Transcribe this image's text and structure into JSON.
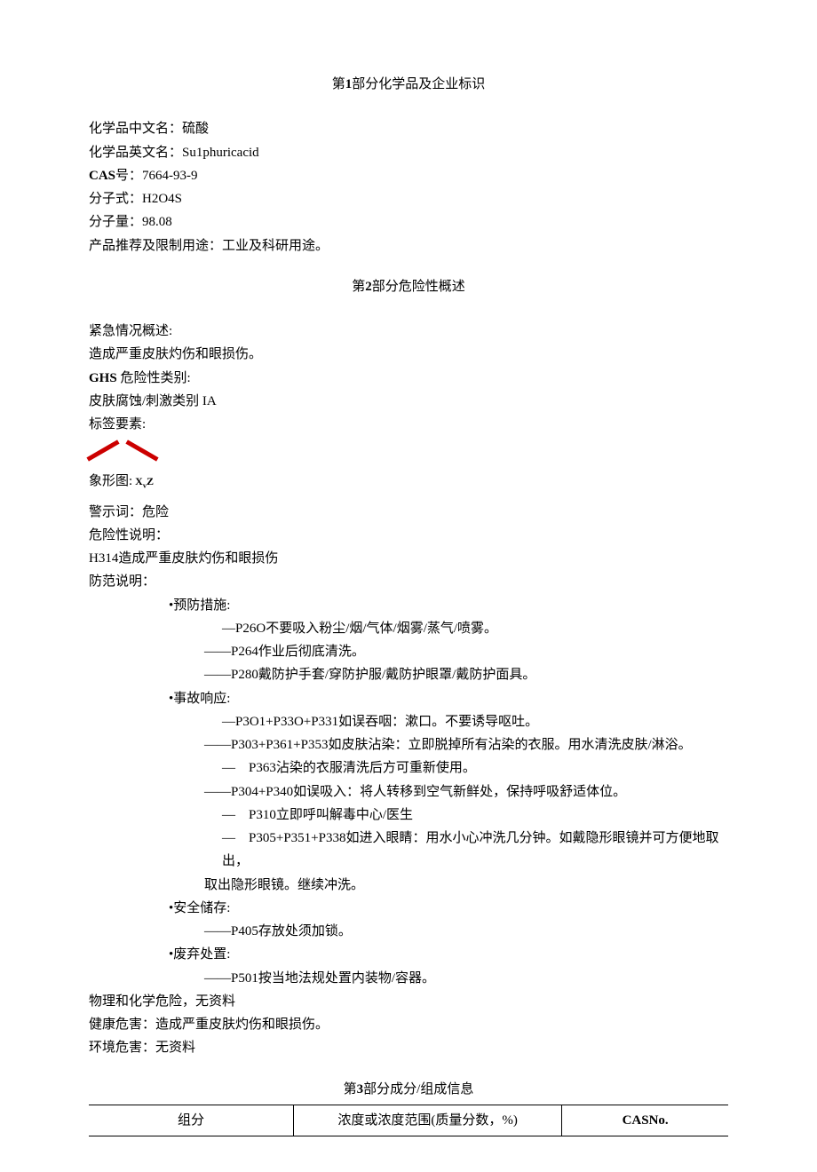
{
  "section1": {
    "title_pre": "第",
    "title_num": "1",
    "title_post": "部分化学品及企业标识",
    "cn_name_label": "化学品中文名：",
    "cn_name_value": "硫酸",
    "en_name_label": "化学品英文名：",
    "en_name_value": "Su1phuricacid",
    "cas_label": "CAS",
    "cas_sep": "号：",
    "cas_value": "7664-93-9",
    "formula_label": "分子式：",
    "formula_value": "H2O4S",
    "mw_label": "分子量：",
    "mw_value": "98.08",
    "usage_label": "产品推荐及限制用途：",
    "usage_value": "工业及科研用途。"
  },
  "section2": {
    "title_pre": "第",
    "title_num": "2",
    "title_post": "部分危险性概述",
    "emergency_label": "紧急情况概述:",
    "emergency_value": "造成严重皮肤灼伤和眼损伤。",
    "ghs_label_bold": "GHS",
    "ghs_label_rest": "危险性类别:",
    "ghs_value_pre": "皮肤腐蚀/刺激类别",
    "ghs_value_lat": " IA",
    "label_elements": "标签要素:",
    "pictogram_label": "象形图:",
    "pictogram_sym": "XvZ",
    "signal_label": "警示词：",
    "signal_value": "危险",
    "hazard_stmt_label": "危险性说明：",
    "h314_code": "H314",
    "h314_text": "造成严重皮肤灼伤和眼损伤",
    "precaution_label": "防范说明：",
    "prevent_h": "•预防措施:",
    "p260_pre": "—",
    "p260_code": "P26O",
    "p260_txt": "不要吸入粉尘/烟/气体/烟雾/蒸气/喷雾。",
    "p264_pre": "——",
    "p264_code": "P264",
    "p264_txt": "作业后彻底清洗。",
    "p280_pre": "——",
    "p280_code": "P280",
    "p280_txt": "戴防护手套/穿防护服/戴防护眼罩/戴防护面具。",
    "response_h": "•事故响应:",
    "p301_pre": "—",
    "p301_code": "P3O1+P33O+P331",
    "p301_txt": "如误吞咽：漱口。不要诱导呕吐。",
    "p303_pre": "——",
    "p303_code": "P303+P361+P353",
    "p303_txt": "如皮肤沾染：立即脱掉所有沾染的衣服。用水清洗皮肤/淋浴。",
    "p363_pre": "—　",
    "p363_code": "P363",
    "p363_txt": "沾染的衣服清洗后方可重新使用。",
    "p304_pre": "——",
    "p304_code": "P304+P340",
    "p304_txt": "如误吸入：将人转移到空气新鲜处，保持呼吸舒适体位。",
    "p310_pre": "—　",
    "p310_code": "P310",
    "p310_txt": "立即呼叫解毒中心/医生",
    "p305_pre": "—　",
    "p305_code": "P305+P351+P338",
    "p305_txt": "如进入眼睛：用水小心冲洗几分钟。如戴隐形眼镜并可方便地取出，",
    "p305_txt2": "取出隐形眼镜。继续冲洗。",
    "storage_h": "•安全储存:",
    "p405_pre": "——",
    "p405_code": "P405",
    "p405_txt": "存放处须加锁。",
    "disposal_h": "•废弃处置:",
    "p501_pre": "——",
    "p501_code": "P501",
    "p501_txt": "按当地法规处置内装物/容器。",
    "phys_chem": "物理和化学危险，无资料",
    "health_label": "健康危害：",
    "health_value": "造成严重皮肤灼伤和眼损伤。",
    "env_label": "环境危害：",
    "env_value": "无资料"
  },
  "section3": {
    "title_pre": "第",
    "title_num": "3",
    "title_post": "部分成分/组成信息",
    "col1": "组分",
    "col2": "浓度或浓度范围(质量分数，%)",
    "col3": "CASNo."
  }
}
